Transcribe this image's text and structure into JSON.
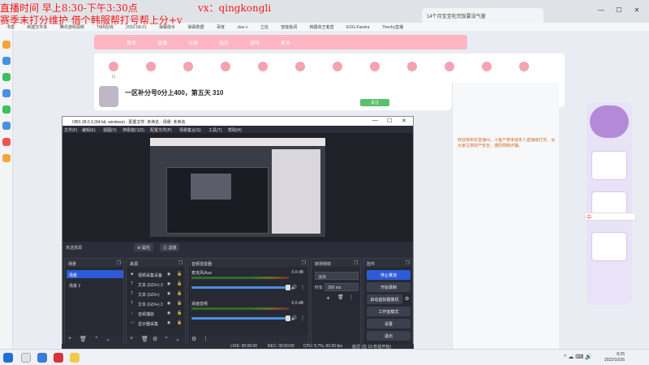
{
  "overlay": {
    "line1": "直播时间 早上8:30-下午3:30点",
    "vx": "vx：qingkongli",
    "line2": "赛季末打分维护 借个韩服帮打号帮上分+v"
  },
  "browser": {
    "tabs": [
      {
        "label": "14个月宝宝吃完饭要没气量"
      },
      {
        "label": "..."
      }
    ],
    "win_minimize": "—",
    "win_maximize": "☐",
    "win_close": "✕",
    "bookmarks": [
      "书签",
      "新建文件夹",
      "腾讯游戏视频",
      "TMA在线",
      "2022-09-21",
      "弹幕助手",
      "弹幕数据",
      "百度",
      "vlao v",
      "立信",
      "智能批阅",
      "韩服高王者直",
      "EDG-Fandra",
      "Theshy直播"
    ]
  },
  "site": {
    "nav": [
      "首页",
      "直播",
      "分类",
      "玩乐",
      "游戏",
      "更多"
    ],
    "sub_items": [
      "11",
      "",
      "",
      "",
      "",
      "",
      "",
      "",
      "",
      "",
      "",
      ""
    ],
    "room_title": "一区补分号0分上400，第五天 310",
    "follow_label": "关注",
    "chat_hl": "欢迎来到本直播间，斗鱼严禁未成年人直播或打赏。请大家注意财产安全，谨防网络诈骗。"
  },
  "sogou": {
    "label": "中·"
  },
  "obs": {
    "title": "OBS 28.0.3 (64-bit, windows) - 配置文件: 未命名 - 场景: 未命名",
    "menu": [
      "文件(F)",
      "编辑(E)",
      "视图(V)",
      "停靠窗口(D)",
      "配置文件(P)",
      "场景集合(S)",
      "工具(T)",
      "帮助(H)"
    ],
    "scene_bar": {
      "label": "未选择源",
      "properties": "属性",
      "filters": "滤镜"
    },
    "docks": {
      "scenes": {
        "title": "场景",
        "items": [
          "场景",
          "场景 2"
        ]
      },
      "sources": {
        "title": "来源",
        "items": [
          {
            "label": "视频采集设备"
          },
          {
            "label": "文本 (GDI+) 3"
          },
          {
            "label": "文本 (GDI+)"
          },
          {
            "label": "文本 (GDI+) 2"
          },
          {
            "label": "音频捕获"
          },
          {
            "label": "显示器采集"
          }
        ]
      },
      "mixer": {
        "title": "音频混音器",
        "channels": [
          {
            "name": "麦克风/Aux",
            "db": "0.0 dB"
          },
          {
            "name": "桌面音频",
            "db": "0.0 dB"
          }
        ]
      },
      "transitions": {
        "title": "转场特效",
        "type": "淡出",
        "duration_label": "时长",
        "duration": "300 ms"
      },
      "controls": {
        "title": "控件",
        "buttons": [
          "停止推流",
          "开始录制",
          "启动虚拟摄像机",
          "工作室模式",
          "设置",
          "退出"
        ]
      }
    },
    "status": {
      "live": "LIVE: 00:00:00",
      "rec": "REC: 00:00:00",
      "cpu": "CPU: 0.7%, 60.00 fps",
      "delay": "延迟 (在 10 秒后开始)"
    }
  },
  "taskbar": {
    "time": "8:25",
    "date": "2022/10/26"
  },
  "colors": {
    "obs_bg": "#2b2e38",
    "obs_primary": "#2d5bd8",
    "site_nav": "#ffb5c2",
    "overlay": "#ee1111"
  },
  "icons": [
    "search-icon",
    "gear-icon",
    "eye-icon",
    "lock-icon",
    "plus-icon",
    "trash-icon",
    "up-arrow-icon",
    "down-arrow-icon"
  ]
}
